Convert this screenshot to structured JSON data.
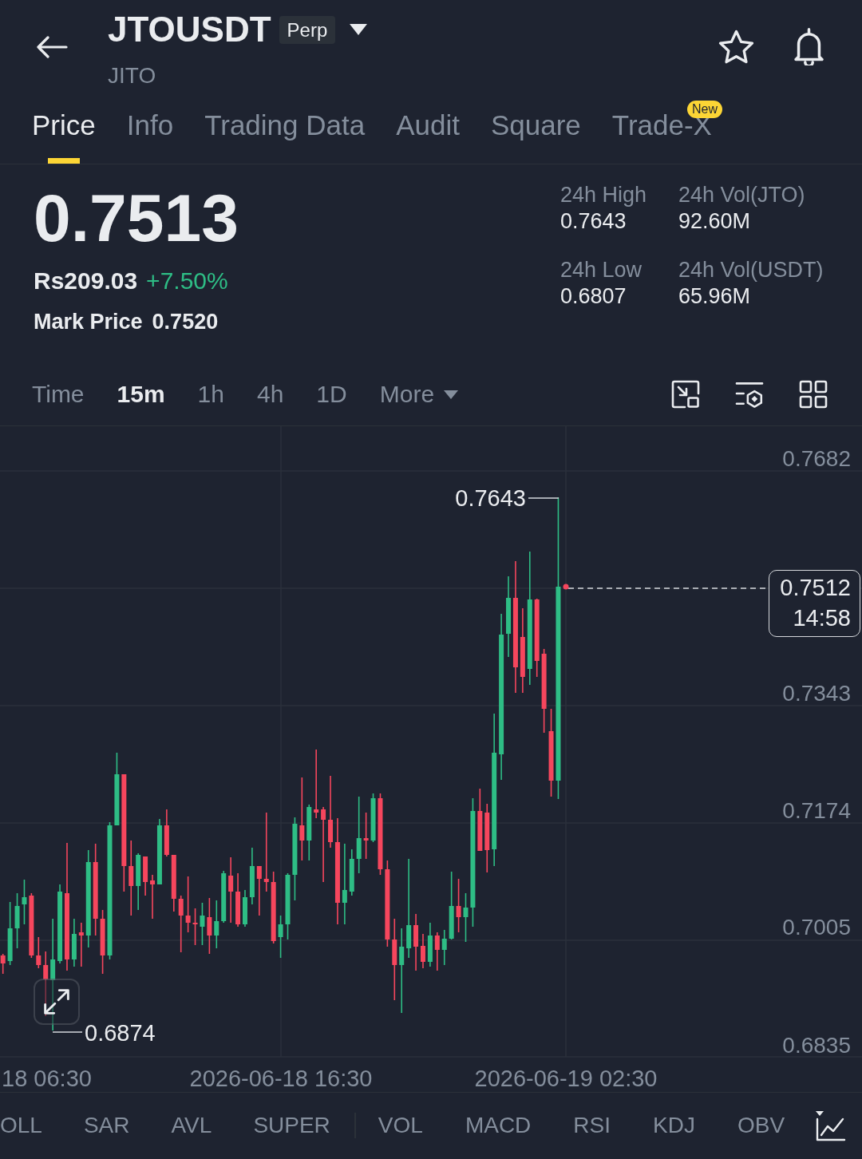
{
  "header": {
    "title": "JTOUSDT",
    "badge": "Perp",
    "subtitle": "JITO",
    "favorite": false
  },
  "tabs": [
    {
      "label": "Price",
      "selected": true
    },
    {
      "label": "Info",
      "selected": false
    },
    {
      "label": "Trading Data",
      "selected": false
    },
    {
      "label": "Audit",
      "selected": false
    },
    {
      "label": "Square",
      "selected": false
    },
    {
      "label": "Trade-X",
      "selected": false,
      "badge": "New"
    }
  ],
  "price": {
    "last_price": "0.7513",
    "fiat_value": "Rs209.03",
    "change": "+7.50%",
    "positive": true,
    "mark_price_label": "Mark Price",
    "mark_price": "0.7520"
  },
  "stats": [
    {
      "label": "24h High",
      "value": "0.7643"
    },
    {
      "label": "24h Vol(JTO)",
      "value": "92.60M"
    },
    {
      "label": "24h Low",
      "value": "0.6807"
    },
    {
      "label": "24h Vol(USDT)",
      "value": "65.96M"
    }
  ],
  "timeframes": [
    {
      "label": "Time",
      "selected": false,
      "kind": "option"
    },
    {
      "label": "15m",
      "selected": true,
      "kind": "option"
    },
    {
      "label": "1h",
      "selected": false,
      "kind": "option"
    },
    {
      "label": "4h",
      "selected": false,
      "kind": "option"
    },
    {
      "label": "1D",
      "selected": false,
      "kind": "option"
    },
    {
      "label": "More",
      "selected": false,
      "kind": "dropdown"
    }
  ],
  "chart": {
    "price_axis": [
      "0.7682",
      "0.7343",
      "0.7174",
      "0.7005",
      "0.6835"
    ],
    "time_axis": [
      "18 06:30",
      "2026-06-18 16:30",
      "2026-06-19 02:30"
    ],
    "high_label": "0.7643",
    "low_label": "0.6874",
    "last_price_tag": {
      "price": "0.7512",
      "countdown": "14:58"
    }
  },
  "indicators": {
    "main": [
      {
        "label": "OLL",
        "selected": false
      },
      {
        "label": "SAR",
        "selected": false
      },
      {
        "label": "AVL",
        "selected": false
      },
      {
        "label": "SUPER",
        "selected": false
      }
    ],
    "sub": [
      {
        "label": "VOL",
        "selected": false
      },
      {
        "label": "MACD",
        "selected": false
      },
      {
        "label": "RSI",
        "selected": false
      },
      {
        "label": "KDJ",
        "selected": false
      },
      {
        "label": "OBV",
        "selected": false
      }
    ]
  }
}
